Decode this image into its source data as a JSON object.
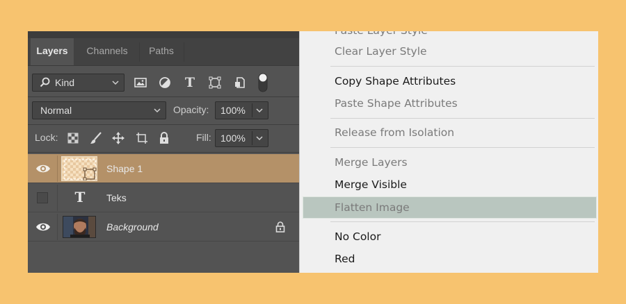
{
  "layers_panel": {
    "tabs": [
      {
        "label": "Layers"
      },
      {
        "label": "Channels"
      },
      {
        "label": "Paths"
      }
    ],
    "filter": {
      "label": "Kind",
      "icon": "search-icon"
    },
    "filter_icons": [
      "image-filter-icon",
      "adjustment-filter-icon",
      "type-filter-icon",
      "shape-filter-icon",
      "smart-object-filter-icon",
      "toggle-filter-icon"
    ],
    "blend_mode": "Normal",
    "opacity_label": "Opacity:",
    "opacity_value": "100%",
    "lock_label": "Lock:",
    "lock_icons": [
      "lock-transparent-icon",
      "lock-paint-icon",
      "lock-position-icon",
      "lock-artboard-icon",
      "lock-all-icon"
    ],
    "fill_label": "Fill:",
    "fill_value": "100%",
    "layers": [
      {
        "name": "Shape 1",
        "visible": true,
        "selected": true,
        "thumb": "shape-thumbnail"
      },
      {
        "name": "Teks",
        "visible": false,
        "selected": false,
        "thumb": "type-icon"
      },
      {
        "name": "Background",
        "visible": true,
        "selected": false,
        "thumb": "photo-thumbnail",
        "locked": true
      }
    ]
  },
  "context_menu": {
    "items": [
      {
        "label": "Paste Layer Style",
        "enabled": false
      },
      {
        "label": "Clear Layer Style",
        "enabled": false
      },
      {
        "label": "Copy Shape Attributes",
        "enabled": true
      },
      {
        "label": "Paste Shape Attributes",
        "enabled": false
      },
      {
        "label": "Release from Isolation",
        "enabled": false
      },
      {
        "label": "Merge Layers",
        "enabled": false
      },
      {
        "label": "Merge Visible",
        "enabled": true
      },
      {
        "label": "Flatten Image",
        "enabled": false,
        "highlighted": true
      },
      {
        "label": "No Color",
        "enabled": true
      },
      {
        "label": "Red",
        "enabled": true
      }
    ]
  },
  "colors": {
    "background": "#f7c36f",
    "panel": "#535353",
    "selected_layer": "#b49168",
    "menu": "#f0f0f0",
    "menu_highlight": "#b9c6bf"
  }
}
